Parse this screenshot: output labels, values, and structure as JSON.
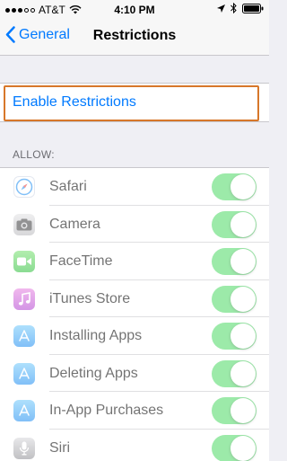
{
  "status_bar": {
    "carrier": "AT&T",
    "time": "4:10 PM"
  },
  "nav": {
    "back_label": "General",
    "title": "Restrictions"
  },
  "enable_restrictions": {
    "label": "Enable Restrictions",
    "highlight_color": "#d7772a"
  },
  "allow_section": {
    "header": "ALLOW:",
    "items": [
      {
        "label": "Safari",
        "icon": "safari-icon",
        "enabled": true
      },
      {
        "label": "Camera",
        "icon": "camera-icon",
        "enabled": true
      },
      {
        "label": "FaceTime",
        "icon": "facetime-icon",
        "enabled": true
      },
      {
        "label": "iTunes Store",
        "icon": "itunes-store-icon",
        "enabled": true
      },
      {
        "label": "Installing Apps",
        "icon": "app-store-icon",
        "enabled": true
      },
      {
        "label": "Deleting Apps",
        "icon": "app-store-icon",
        "enabled": true
      },
      {
        "label": "In-App Purchases",
        "icon": "app-store-icon",
        "enabled": true
      },
      {
        "label": "Siri",
        "icon": "siri-icon",
        "enabled": true
      }
    ]
  },
  "colors": {
    "accent": "#007aff",
    "toggle_on": "#4cd964",
    "background": "#efeff4"
  }
}
